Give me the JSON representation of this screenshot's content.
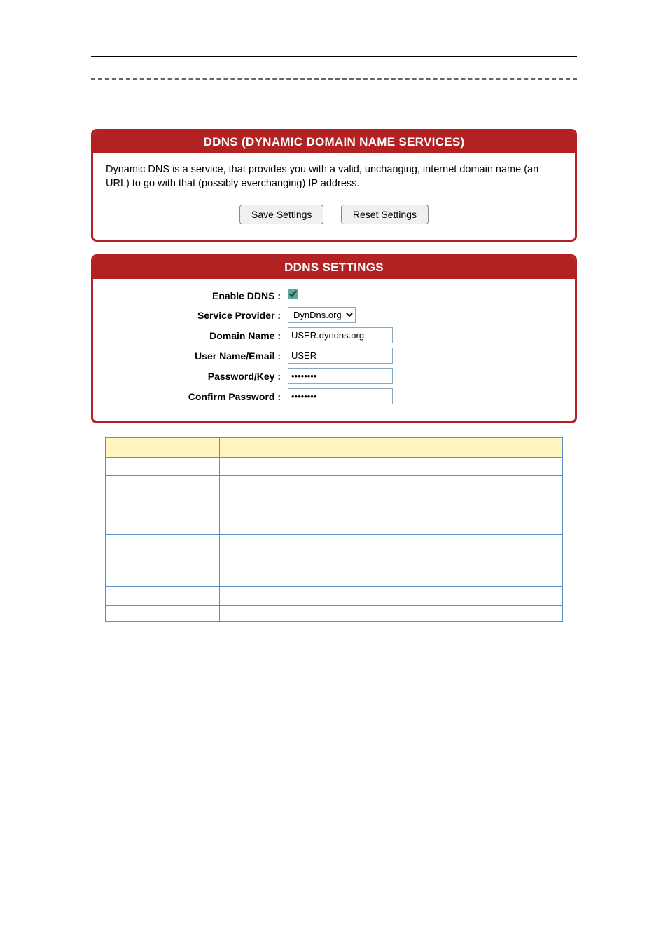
{
  "panel1": {
    "title": "DDNS (DYNAMIC DOMAIN NAME SERVICES)",
    "description": "Dynamic DNS is a service, that provides you with a valid, unchanging, internet domain name (an URL) to go with that (possibly everchanging) IP address.",
    "save_label": "Save Settings",
    "reset_label": "Reset Settings"
  },
  "panel2": {
    "title": "DDNS SETTINGS",
    "fields": {
      "enable": {
        "label": "Enable DDNS :",
        "checked": true
      },
      "provider": {
        "label": "Service Provider :",
        "value": "DynDns.org"
      },
      "domain": {
        "label": "Domain Name :",
        "value": "USER.dyndns.org"
      },
      "user": {
        "label": "User Name/Email :",
        "value": "USER"
      },
      "password": {
        "label": "Password/Key :",
        "value": "••••••••"
      },
      "confirm": {
        "label": "Confirm Password :",
        "value": "••••••••"
      }
    }
  },
  "info_table": {
    "header": [
      "",
      ""
    ],
    "rows": [
      [
        "",
        ""
      ],
      [
        "",
        ""
      ],
      [
        "",
        ""
      ],
      [
        "",
        ""
      ],
      [
        "",
        ""
      ],
      [
        "",
        ""
      ]
    ]
  }
}
